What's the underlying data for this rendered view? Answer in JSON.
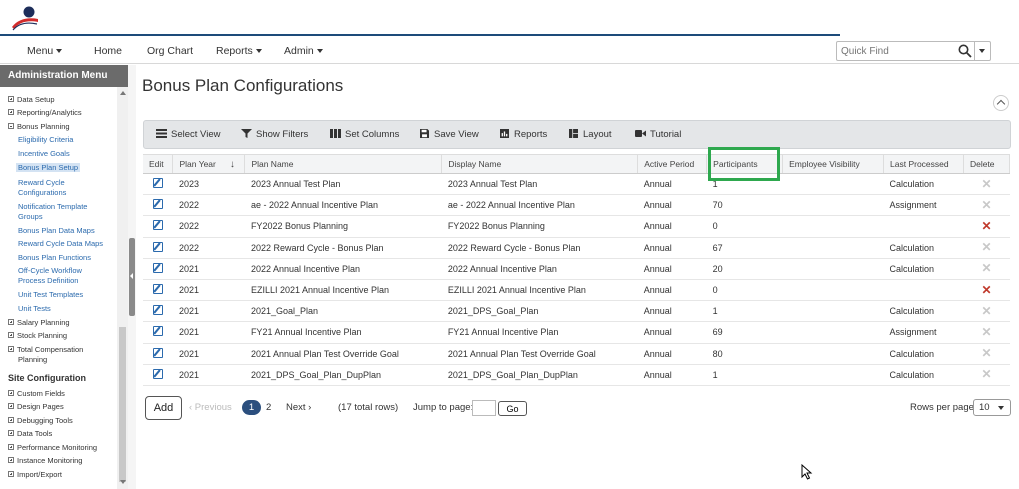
{
  "nav": {
    "menu": "Menu",
    "home": "Home",
    "org_chart": "Org Chart",
    "reports": "Reports",
    "admin": "Admin",
    "quick_find_placeholder": "Quick Find"
  },
  "sidebar": {
    "header": "Administration Menu",
    "admin_groups": [
      {
        "label": "Data Setup",
        "expanded": false
      },
      {
        "label": "Reporting/Analytics",
        "expanded": false
      },
      {
        "label": "Bonus Planning",
        "expanded": true
      }
    ],
    "bonus_items": [
      "Eligibility Criteria",
      "Incentive Goals",
      "Bonus Plan Setup",
      "Reward Cycle",
      "Configurations",
      "Notification Template",
      "Groups",
      "Bonus Plan Data Maps",
      "Reward Cycle Data Maps",
      "Bonus Plan Functions",
      "Off-Cycle Workflow",
      "Process Definition",
      "Unit Test Templates",
      "Unit Tests"
    ],
    "active_item": "Bonus Plan Setup",
    "other_groups": [
      "Salary Planning",
      "Stock Planning",
      "Total Compensation",
      "Planning"
    ],
    "site_config_title": "Site Configuration",
    "site_groups": [
      "Custom Fields",
      "Design Pages",
      "Debugging Tools",
      "Data Tools",
      "Performance Monitoring",
      "Instance Monitoring",
      "Import/Export"
    ]
  },
  "page": {
    "title": "Bonus Plan Configurations"
  },
  "toolbar": {
    "select_view": "Select View",
    "show_filters": "Show Filters",
    "set_columns": "Set Columns",
    "save_view": "Save View",
    "reports": "Reports",
    "layout": "Layout",
    "tutorial": "Tutorial"
  },
  "table": {
    "headers": {
      "edit": "Edit",
      "plan_year": "Plan Year",
      "plan_name": "Plan Name",
      "display_name": "Display Name",
      "active_period": "Active Period",
      "participants": "Participants",
      "employee_visibility": "Employee Visibility",
      "last_processed": "Last Processed",
      "delete": "Delete"
    },
    "sort_indicator": "↓",
    "rows": [
      {
        "year": "2023",
        "plan": "2023 Annual Test Plan",
        "display": "2023 Annual Test Plan",
        "period": "Annual",
        "participants": "1",
        "visibility": "",
        "processed": "Calculation",
        "deletable": false
      },
      {
        "year": "2022",
        "plan": "ae - 2022 Annual Incentive Plan",
        "display": "ae - 2022 Annual Incentive Plan",
        "period": "Annual",
        "participants": "70",
        "visibility": "",
        "processed": "Assignment",
        "deletable": false
      },
      {
        "year": "2022",
        "plan": "FY2022 Bonus Planning",
        "display": "FY2022 Bonus Planning",
        "period": "Annual",
        "participants": "0",
        "visibility": "",
        "processed": "",
        "deletable": true
      },
      {
        "year": "2022",
        "plan": "2022 Reward Cycle - Bonus Plan",
        "display": "2022 Reward Cycle - Bonus Plan",
        "period": "Annual",
        "participants": "67",
        "visibility": "",
        "processed": "Calculation",
        "deletable": false
      },
      {
        "year": "2021",
        "plan": "2022 Annual Incentive Plan",
        "display": "2022 Annual Incentive Plan",
        "period": "Annual",
        "participants": "20",
        "visibility": "",
        "processed": "Calculation",
        "deletable": false
      },
      {
        "year": "2021",
        "plan": "EZILLI 2021 Annual Incentive Plan",
        "display": "EZILLI 2021 Annual Incentive Plan",
        "period": "Annual",
        "participants": "0",
        "visibility": "",
        "processed": "",
        "deletable": true
      },
      {
        "year": "2021",
        "plan": "2021_Goal_Plan",
        "display": "2021_DPS_Goal_Plan",
        "period": "Annual",
        "participants": "1",
        "visibility": "",
        "processed": "Calculation",
        "deletable": false
      },
      {
        "year": "2021",
        "plan": "FY21 Annual Incentive Plan",
        "display": "FY21 Annual Incentive Plan",
        "period": "Annual",
        "participants": "69",
        "visibility": "",
        "processed": "Assignment",
        "deletable": false
      },
      {
        "year": "2021",
        "plan": "2021 Annual Plan Test Override Goal",
        "display": "2021 Annual Plan Test Override Goal",
        "period": "Annual",
        "participants": "80",
        "visibility": "",
        "processed": "Calculation",
        "deletable": false
      },
      {
        "year": "2021",
        "plan": "2021_DPS_Goal_Plan_DupPlan",
        "display": "2021_DPS_Goal_Plan_DupPlan",
        "period": "Annual",
        "participants": "1",
        "visibility": "",
        "processed": "Calculation",
        "deletable": false
      }
    ]
  },
  "footer": {
    "add": "Add",
    "previous": "‹ Previous",
    "page1": "1",
    "page2": "2",
    "next": "Next ›",
    "total": "(17 total rows)",
    "jump_label": "Jump to page:",
    "jump_value": "",
    "go": "Go",
    "rows_per_page_label": "Rows per page:",
    "rows_per_page": "10"
  },
  "colors": {
    "brand_navy": "#1d4b7a",
    "link_blue": "#2b6aad",
    "highlight_green": "#2ea84e",
    "delete_red": "#c0392b"
  },
  "icons": [
    "logo",
    "search-icon",
    "select-view-icon",
    "filter-icon",
    "columns-icon",
    "save-icon",
    "reports-icon",
    "layout-icon",
    "video-icon",
    "edit-icon",
    "delete-icon",
    "collapse-icon",
    "mouse-cursor"
  ]
}
